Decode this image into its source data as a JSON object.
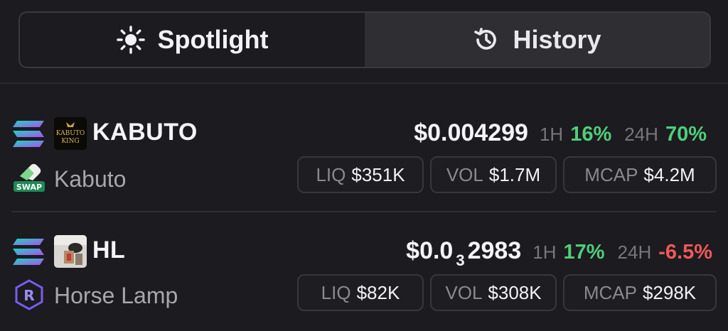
{
  "tabs": [
    {
      "label": "Spotlight",
      "icon": "sun-icon",
      "active": true
    },
    {
      "label": "History",
      "icon": "history-icon",
      "active": false
    }
  ],
  "tokens": [
    {
      "symbol": "KABUTO",
      "name": "Kabuto",
      "logo_text_line1": "KABUTO",
      "logo_text_line2": "KING",
      "price_main": "$0.004299",
      "price_sub": "",
      "price_tail": "",
      "h1_label": "1H",
      "h1_change": "16%",
      "h24_label": "24H",
      "h24_change": "70%",
      "h24_direction": "up",
      "dex_label": "SWAP",
      "stats": {
        "liq_label": "LIQ",
        "liq": "$351K",
        "vol_label": "VOL",
        "vol": "$1.7M",
        "mcap_label": "MCAP",
        "mcap": "$4.2M"
      }
    },
    {
      "symbol": "HL",
      "name": "Horse Lamp",
      "price_main": "$0.0",
      "price_sub": "3",
      "price_tail": "2983",
      "h1_label": "1H",
      "h1_change": "17%",
      "h24_label": "24H",
      "h24_change": "-6.5%",
      "h24_direction": "down",
      "dex_label": "R",
      "stats": {
        "liq_label": "LIQ",
        "liq": "$82K",
        "vol_label": "VOL",
        "vol": "$308K",
        "mcap_label": "MCAP",
        "mcap": "$298K"
      }
    }
  ],
  "colors": {
    "background": "#1c1b1f",
    "positive": "#4fce7b",
    "negative": "#ee5a5a",
    "muted": "#77767c"
  }
}
